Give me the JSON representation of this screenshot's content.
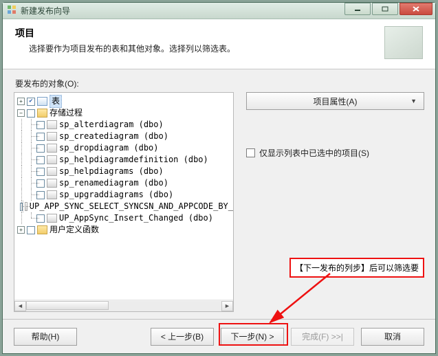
{
  "window": {
    "title": "新建发布向导"
  },
  "header": {
    "title": "项目",
    "subtitle": "选择要作为项目发布的表和其他对象。选择列以筛选表。"
  },
  "body": {
    "objects_label": "要发布的对象(O):",
    "tree": {
      "root_tables_label": "表",
      "root_sp_label": "存储过程",
      "root_udf_label": "用户定义函数",
      "sp_items": [
        "sp_alterdiagram (dbo)",
        "sp_creatediagram (dbo)",
        "sp_dropdiagram (dbo)",
        "sp_helpdiagramdefinition (dbo)",
        "sp_helpdiagrams (dbo)",
        "sp_renamediagram (dbo)",
        "sp_upgraddiagrams (dbo)",
        "UP_APP_SYNC_SELECT_SYNCSN_AND_APPCODE_BY_",
        "UP_AppSync_Insert_Changed (dbo)"
      ]
    },
    "right": {
      "properties_button": "项目属性(A)",
      "show_selected_only": "仅显示列表中已选中的项目(S)"
    }
  },
  "callout": {
    "text": "【下一发布的列步】后可以筛选要"
  },
  "footer": {
    "help": "帮助(H)",
    "back": "< 上一步(B)",
    "next": "下一步(N) >",
    "finish": "完成(F) >>|",
    "cancel": "取消"
  }
}
